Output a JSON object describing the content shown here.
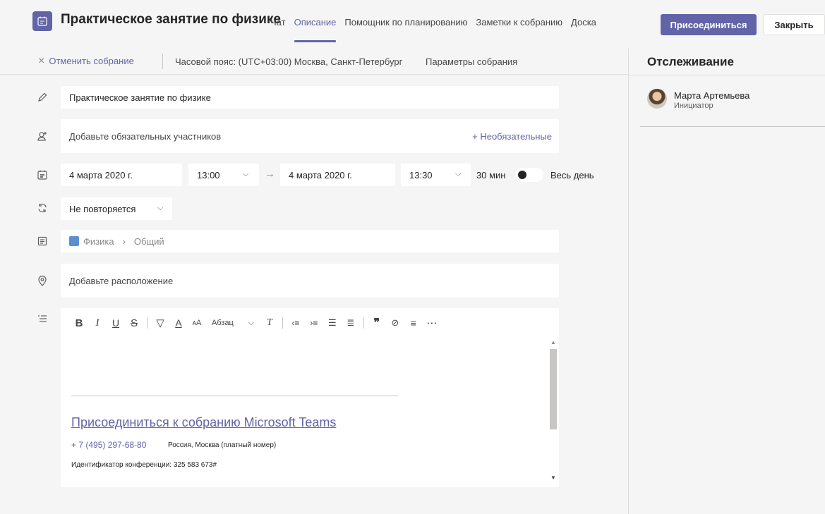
{
  "header": {
    "title": "Практическое занятие по физике",
    "tabs": [
      {
        "label": "Чат",
        "active": false
      },
      {
        "label": "Описание",
        "active": true
      },
      {
        "label": "Помощник по планированию",
        "active": false
      },
      {
        "label": "Заметки к собранию",
        "active": false
      },
      {
        "label": "Доска",
        "active": false
      }
    ],
    "join_label": "Присоединиться",
    "close_label": "Закрыть"
  },
  "toolbar": {
    "cancel_label": "Отменить собрание",
    "timezone": "Часовой пояс: (UTC+03:00) Москва, Санкт-Петербург",
    "params_label": "Параметры собрания"
  },
  "tracking": {
    "title": "Отслеживание",
    "person_name": "Марта Артемьева",
    "person_role": "Инициатор"
  },
  "form": {
    "meeting_title": "Практическое занятие по физике",
    "attendees_placeholder": "Добавьте обязательных участников",
    "optional_label": "+ Необязательные",
    "start_date": "4 марта 2020 г.",
    "start_time": "13:00",
    "end_date": "4 марта 2020 г.",
    "end_time": "13:30",
    "duration": "30 мин",
    "all_day_label": "Весь день",
    "all_day_on": false,
    "repeat": "Не повторяется",
    "channel_team": "Физика",
    "channel_name": "Общий",
    "location_placeholder": "Добавьте расположение"
  },
  "editor": {
    "paragraph_label": "Абзац",
    "join_link": "Присоединиться к собранию Microsoft Teams",
    "phone": "+ 7 (495) 297-68-80",
    "phone_note": "Россия, Москва (платный номер)",
    "conference_id": "Идентификатор конференции: 325 583 673#"
  },
  "colors": {
    "accent": "#6264a7",
    "background": "#f5f5f5",
    "field": "#ffffff"
  }
}
